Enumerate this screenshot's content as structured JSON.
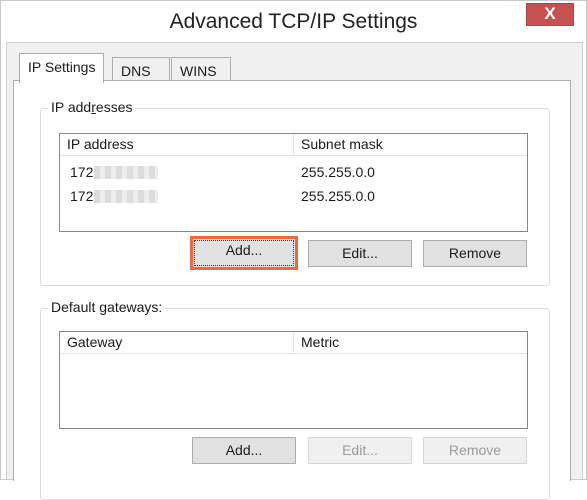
{
  "window": {
    "title": "Advanced TCP/IP Settings",
    "close_glyph": "X"
  },
  "tabs": [
    {
      "label": "IP Settings",
      "active": true
    },
    {
      "label": "DNS",
      "active": false
    },
    {
      "label": "WINS",
      "active": false
    }
  ],
  "ip_addresses": {
    "group_label": "IP addresses",
    "columns": [
      "IP address",
      "Subnet mask"
    ],
    "rows": [
      {
        "ip_prefix": "172",
        "subnet": "255.255.0.0"
      },
      {
        "ip_prefix": "172",
        "subnet": "255.255.0.0"
      }
    ],
    "buttons": {
      "add": "Add...",
      "edit": "Edit...",
      "remove": "Remove"
    }
  },
  "gateways": {
    "group_label": "Default gateways:",
    "columns": [
      "Gateway",
      "Metric"
    ],
    "buttons": {
      "add": "Add...",
      "edit": "Edit...",
      "remove": "Remove"
    }
  },
  "colors": {
    "close_button": "#c75050",
    "focus_highlight": "#ef6a3a"
  },
  "icons": {
    "close": "close-icon"
  }
}
